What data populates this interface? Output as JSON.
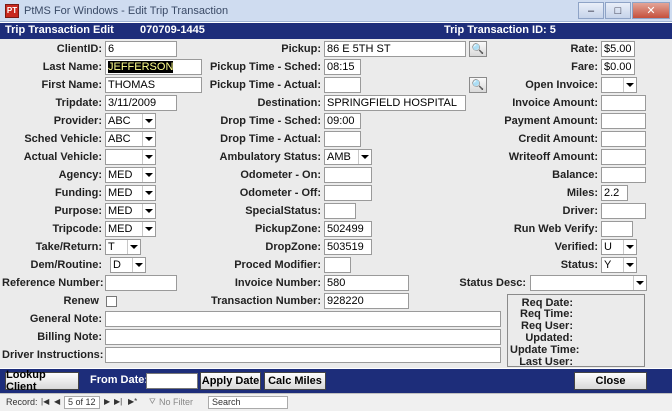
{
  "window": {
    "title": "PtMS For Windows - Edit Trip Transaction",
    "app_icon": "PT"
  },
  "header": {
    "form_title": "Trip Transaction Edit",
    "code": "070709-1445",
    "trip_id_label": "Trip Transaction ID: 5"
  },
  "fields": {
    "client_id": {
      "label": "ClientID:",
      "value": "6"
    },
    "last_name": {
      "label": "Last Name:",
      "value": "JEFFERSON"
    },
    "first_name": {
      "label": "First Name:",
      "value": "THOMAS"
    },
    "tripdate": {
      "label": "Tripdate:",
      "value": "3/11/2009"
    },
    "provider": {
      "label": "Provider:",
      "value": "ABC"
    },
    "sched_vehicle": {
      "label": "Sched Vehicle:",
      "value": "ABC"
    },
    "actual_vehicle": {
      "label": "Actual Vehicle:",
      "value": ""
    },
    "agency": {
      "label": "Agency:",
      "value": "MED"
    },
    "funding": {
      "label": "Funding:",
      "value": "MED"
    },
    "purpose": {
      "label": "Purpose:",
      "value": "MED"
    },
    "tripcode": {
      "label": "Tripcode:",
      "value": "MED"
    },
    "take_return": {
      "label": "Take/Return:",
      "value": "T"
    },
    "dem_routine": {
      "label": "Dem/Routine:",
      "value": "D"
    },
    "reference_number": {
      "label": "Reference Number:",
      "value": ""
    },
    "renew": {
      "label": "Renew"
    },
    "general_note": {
      "label": "General Note:",
      "value": ""
    },
    "billing_note": {
      "label": "Billing Note:",
      "value": ""
    },
    "driver_instructions": {
      "label": "Driver Instructions:",
      "value": ""
    },
    "pickup": {
      "label": "Pickup:",
      "value": "86 E 5TH ST"
    },
    "pickup_sched": {
      "label": "Pickup Time - Sched:",
      "value": "08:15"
    },
    "pickup_actual": {
      "label": "Pickup Time - Actual:",
      "value": ""
    },
    "destination": {
      "label": "Destination:",
      "value": "SPRINGFIELD HOSPITAL"
    },
    "drop_sched": {
      "label": "Drop Time - Sched:",
      "value": "09:00"
    },
    "drop_actual": {
      "label": "Drop Time - Actual:",
      "value": ""
    },
    "ambulatory_status": {
      "label": "Ambulatory Status:",
      "value": "AMB"
    },
    "odometer_on": {
      "label": "Odometer - On:",
      "value": ""
    },
    "odometer_off": {
      "label": "Odometer - Off:",
      "value": ""
    },
    "special_status": {
      "label": "SpecialStatus:",
      "value": ""
    },
    "pickup_zone": {
      "label": "PickupZone:",
      "value": "502499"
    },
    "drop_zone": {
      "label": "DropZone:",
      "value": "503519"
    },
    "proced_modifier": {
      "label": "Proced Modifier:",
      "value": ""
    },
    "invoice_number": {
      "label": "Invoice Number:",
      "value": "580"
    },
    "transaction_number": {
      "label": "Transaction Number:",
      "value": "928220"
    },
    "rate": {
      "label": "Rate:",
      "value": "$5.00"
    },
    "fare": {
      "label": "Fare:",
      "value": "$0.00"
    },
    "open_invoice": {
      "label": "Open Invoice:",
      "value": ""
    },
    "invoice_amount": {
      "label": "Invoice Amount:",
      "value": ""
    },
    "payment_amount": {
      "label": "Payment Amount:",
      "value": ""
    },
    "credit_amount": {
      "label": "Credit Amount:",
      "value": ""
    },
    "writeoff_amount": {
      "label": "Writeoff Amount:",
      "value": ""
    },
    "balance": {
      "label": "Balance:",
      "value": ""
    },
    "miles": {
      "label": "Miles:",
      "value": "2.2"
    },
    "driver": {
      "label": "Driver:",
      "value": ""
    },
    "run_web_verify": {
      "label": "Run Web Verify:",
      "value": ""
    },
    "verified": {
      "label": "Verified:",
      "value": "U"
    },
    "status": {
      "label": "Status:",
      "value": "Y"
    },
    "status_desc": {
      "label": "Status Desc:",
      "value": ""
    }
  },
  "info": {
    "req_date": "Req Date:",
    "req_time": "Req Time:",
    "req_user": "Req User:",
    "updated": "Updated:",
    "update_time": "Update Time:",
    "last_user": "Last User:"
  },
  "toolbar": {
    "lookup_client": "Lookup Client",
    "from_date": "From Date:",
    "apply_date": "Apply Date",
    "calc_miles": "Calc Miles",
    "close": "Close"
  },
  "navbar": {
    "record_label": "Record:",
    "record_value": "5 of 12",
    "no_filter": "No Filter",
    "search": "Search"
  },
  "icons": {
    "binoculars": "binoculars-icon",
    "dropdown": "chevron-down-icon"
  }
}
